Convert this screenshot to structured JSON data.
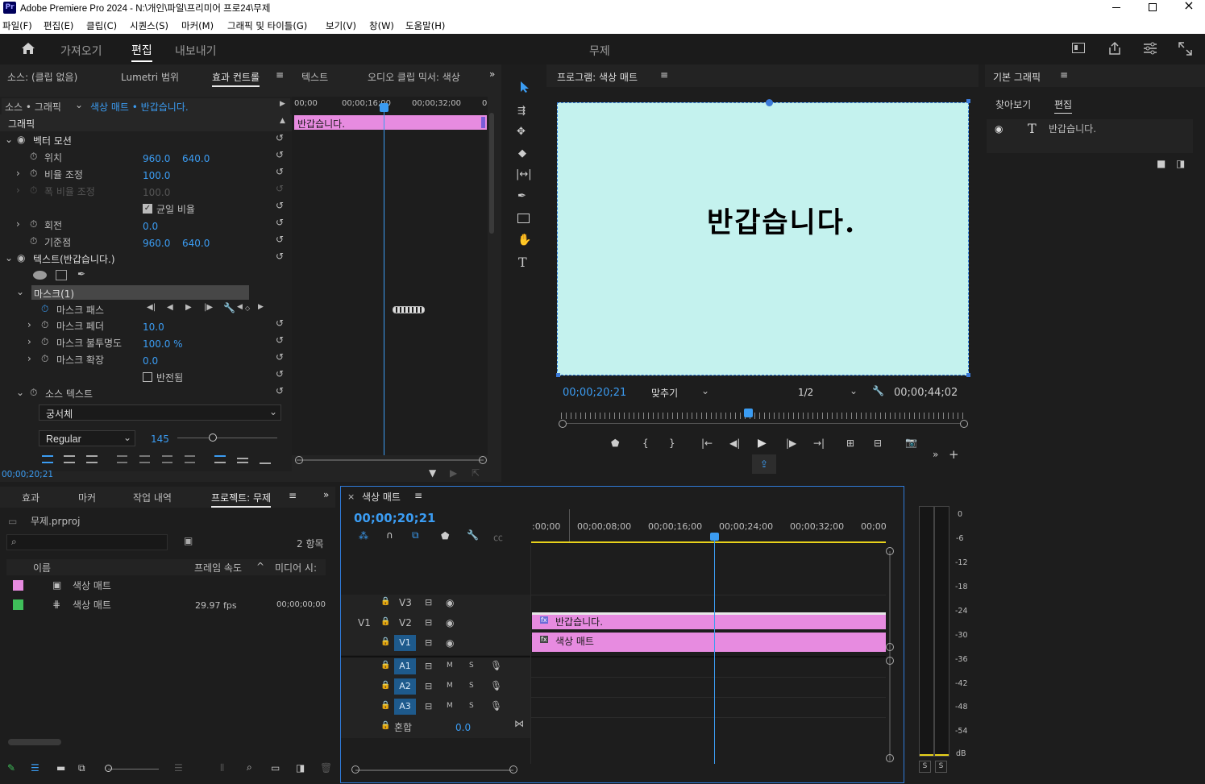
{
  "title_bar": {
    "app_title": "Adobe Premiere Pro 2024 - N:\\개인\\파일\\프리미어 프로24\\무제"
  },
  "menu": [
    "파일(F)",
    "편집(E)",
    "클립(C)",
    "시퀀스(S)",
    "마커(M)",
    "그래픽 및 타이틀(G)",
    "보기(V)",
    "창(W)",
    "도움말(H)"
  ],
  "workspace_tabs": {
    "import": "가져오기",
    "edit": "편집",
    "export": "내보내기",
    "project_title": "무제"
  },
  "source_panel_tabs": {
    "source": "소스: (클립 없음)",
    "lumetri": "Lumetri 범위",
    "effect_controls": "효과 컨트롤",
    "text": "텍스트",
    "audio_mixer": "오디오 클립 믹서: 색상"
  },
  "effect_controls": {
    "clip_label": "소스 • 그래픽",
    "clip_path": "색상 매트 • 반갑습니다.",
    "section": "그래픽",
    "ruler": [
      "00;00",
      "00;00;16;00",
      "00;00;32;00",
      "0"
    ],
    "clip_bar": "반갑습니다.",
    "vector_motion": "벡터 모션",
    "position_label": "위치",
    "position_x": "960.0",
    "position_y": "640.0",
    "scale_label": "비율 조정",
    "scale_value": "100.0",
    "scale_width_label": "폭 비율 조정",
    "scale_width_value": "100.0",
    "uniform_label": "균일 비율",
    "rotation_label": "회전",
    "rotation_value": "0.0",
    "anchor_label": "기준점",
    "anchor_x": "960.0",
    "anchor_y": "640.0",
    "text_layer": "텍스트(반갑습니다.)",
    "mask_label": "마스크(1)",
    "mask_path": "마스크 패스",
    "mask_feather_label": "마스크 페더",
    "mask_feather_value": "10.0",
    "mask_opacity_label": "마스크 불투명도",
    "mask_opacity_value": "100.0 %",
    "mask_expansion_label": "마스크 확장",
    "mask_expansion_value": "0.0",
    "inverted_label": "반전됨",
    "source_text_label": "소스 텍스트",
    "font": "궁서체",
    "font_style": "Regular",
    "font_size": "145",
    "timecode": "00;00;20;21"
  },
  "program_monitor": {
    "title": "프로그램: 색상 매트",
    "overlay_text": "반갑습니다.",
    "current_time": "00;00;20;21",
    "fit": "맞추기",
    "resolution": "1/2",
    "duration": "00;00;44;02",
    "canvas_color": "#c4f2ee"
  },
  "tools": [
    "selection-tool",
    "track-select-tool",
    "ripple-edit-tool",
    "razor-tool",
    "slip-tool",
    "pen-tool",
    "rectangle-tool",
    "hand-tool",
    "type-tool"
  ],
  "essential_graphics": {
    "title": "기본 그래픽",
    "tab_browse": "찾아보기",
    "tab_edit": "편집",
    "layer_name": "반갑습니다."
  },
  "project_panel": {
    "tabs": [
      "효과",
      "마커",
      "작업 내역",
      "프로젝트: 무제"
    ],
    "file": "무제.prproj",
    "items_count": "2 항목",
    "col_name": "이름",
    "col_fps": "프레임 속도",
    "col_media": "미디어 시:",
    "items": [
      {
        "name": "색상 매트",
        "fps": "",
        "media": "",
        "color": "#e78be0"
      },
      {
        "name": "색상 매트",
        "fps": "29.97 fps",
        "media": "00;00;00;00",
        "color": "#3fbf5a"
      }
    ]
  },
  "timeline": {
    "sequence": "색상 매트",
    "timecode": "00;00;20;21",
    "ruler": [
      ":00;00",
      "00;00;08;00",
      "00;00;16;00",
      "00;00;24;00",
      "00;00;32;00",
      "00;00"
    ],
    "tracks": {
      "v3": "V3",
      "v2": "V2",
      "v1": "V1",
      "source_v1": "V1",
      "a1": "A1",
      "a2": "A2",
      "a3": "A3",
      "mix": "혼합",
      "mix_value": "0.0",
      "m": "M",
      "s": "S"
    },
    "clips": {
      "v2": "반갑습니다.",
      "v1": "색상 매트"
    }
  },
  "meter": {
    "scale": [
      "0",
      "-6",
      "-12",
      "-18",
      "-24",
      "-30",
      "-36",
      "-42",
      "-48",
      "-54",
      "dB"
    ],
    "solo": "S"
  }
}
